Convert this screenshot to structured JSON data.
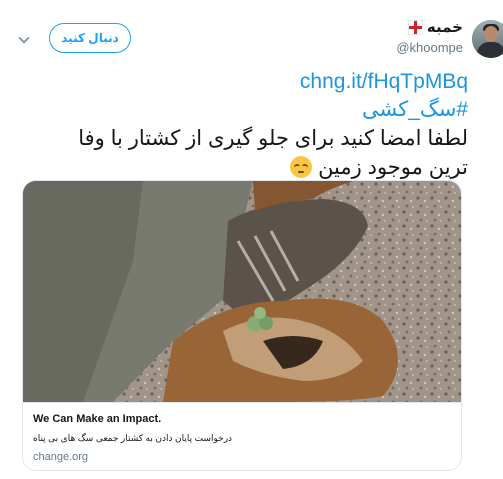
{
  "user": {
    "display_name": "خمبه",
    "handle": "@khoompe",
    "follow_label": "دنبال کنید"
  },
  "tweet": {
    "link": "chng.it/fHqTpMBq",
    "hashtag": "#سگ_کشی",
    "line1": "لطفا امضا کنید برای جلو گیری از کشتار با وفا",
    "line2": "ترین موجود زمین",
    "emoji": "pensive-face"
  },
  "card": {
    "title": "We Can Make an Impact.",
    "description": "درخواست پایان دادن به کشتار جمعی سگ های بی پناه",
    "domain": "change.org"
  },
  "colors": {
    "accent": "#1da1f2",
    "link": "#1b95e0",
    "muted": "#657786",
    "flag_red": "#d4202a"
  }
}
